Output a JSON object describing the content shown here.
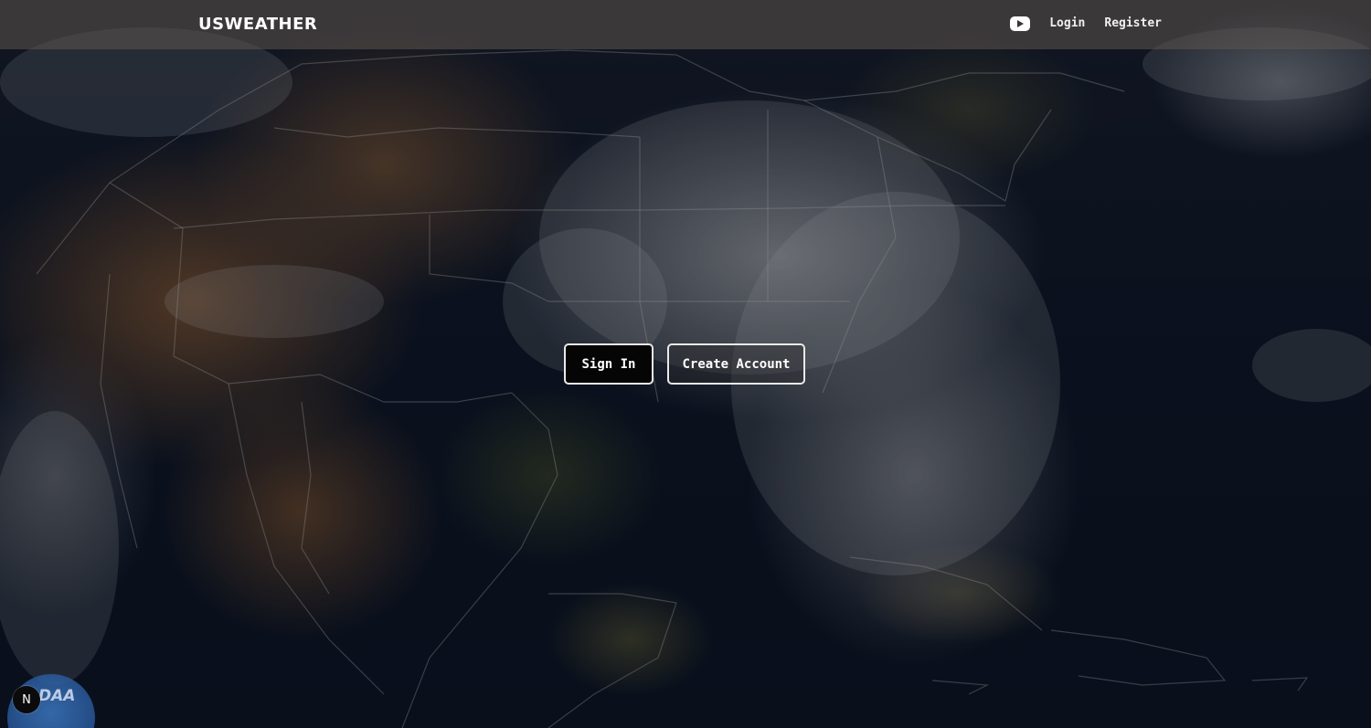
{
  "header": {
    "logo_text": "USWEATHER",
    "nav": {
      "youtube_icon": "youtube-icon",
      "login_label": "Login",
      "register_label": "Register"
    }
  },
  "hero": {
    "sign_in_label": "Sign In",
    "create_account_label": "Create Account"
  },
  "footer_badges": {
    "noaa_text": "DAA",
    "north_label": "N"
  },
  "colors": {
    "header_bg": "#5f5550",
    "button_border": "#e9e9e9",
    "sign_in_bg": "#050505",
    "text": "#ffffff"
  }
}
